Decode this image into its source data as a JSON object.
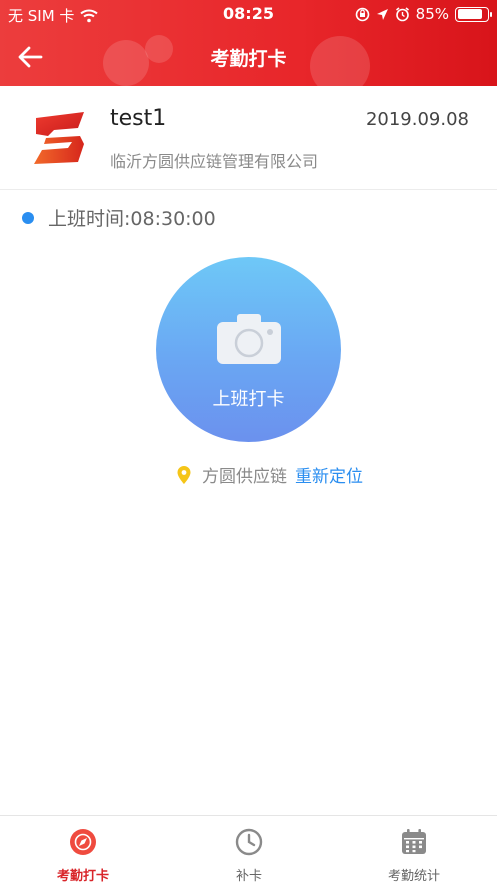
{
  "status_bar": {
    "carrier": "无 SIM 卡",
    "time": "08:25",
    "battery": "85%",
    "battery_level": 0.85
  },
  "nav": {
    "title": "考勤打卡",
    "back_icon": "arrow-left-icon"
  },
  "profile": {
    "username": "test1",
    "company": "临沂方圆供应链管理有限公司",
    "date": "2019.09.08"
  },
  "work": {
    "time_label": "上班时间:08:30:00",
    "punch_label": "上班打卡",
    "location_name": "方圆供应链",
    "relocate_label": "重新定位"
  },
  "tabs": [
    {
      "label": "考勤打卡",
      "icon": "compass-icon",
      "active": true
    },
    {
      "label": "补卡",
      "icon": "clock-icon",
      "active": false
    },
    {
      "label": "考勤统计",
      "icon": "calendar-icon",
      "active": false
    }
  ],
  "colors": {
    "brand_red": "#e8262a",
    "accent_blue": "#2a8ef0",
    "button_gradient_top": "#6ec8f7",
    "button_gradient_bottom": "#6b91ee",
    "pin_yellow": "#f5c518"
  }
}
